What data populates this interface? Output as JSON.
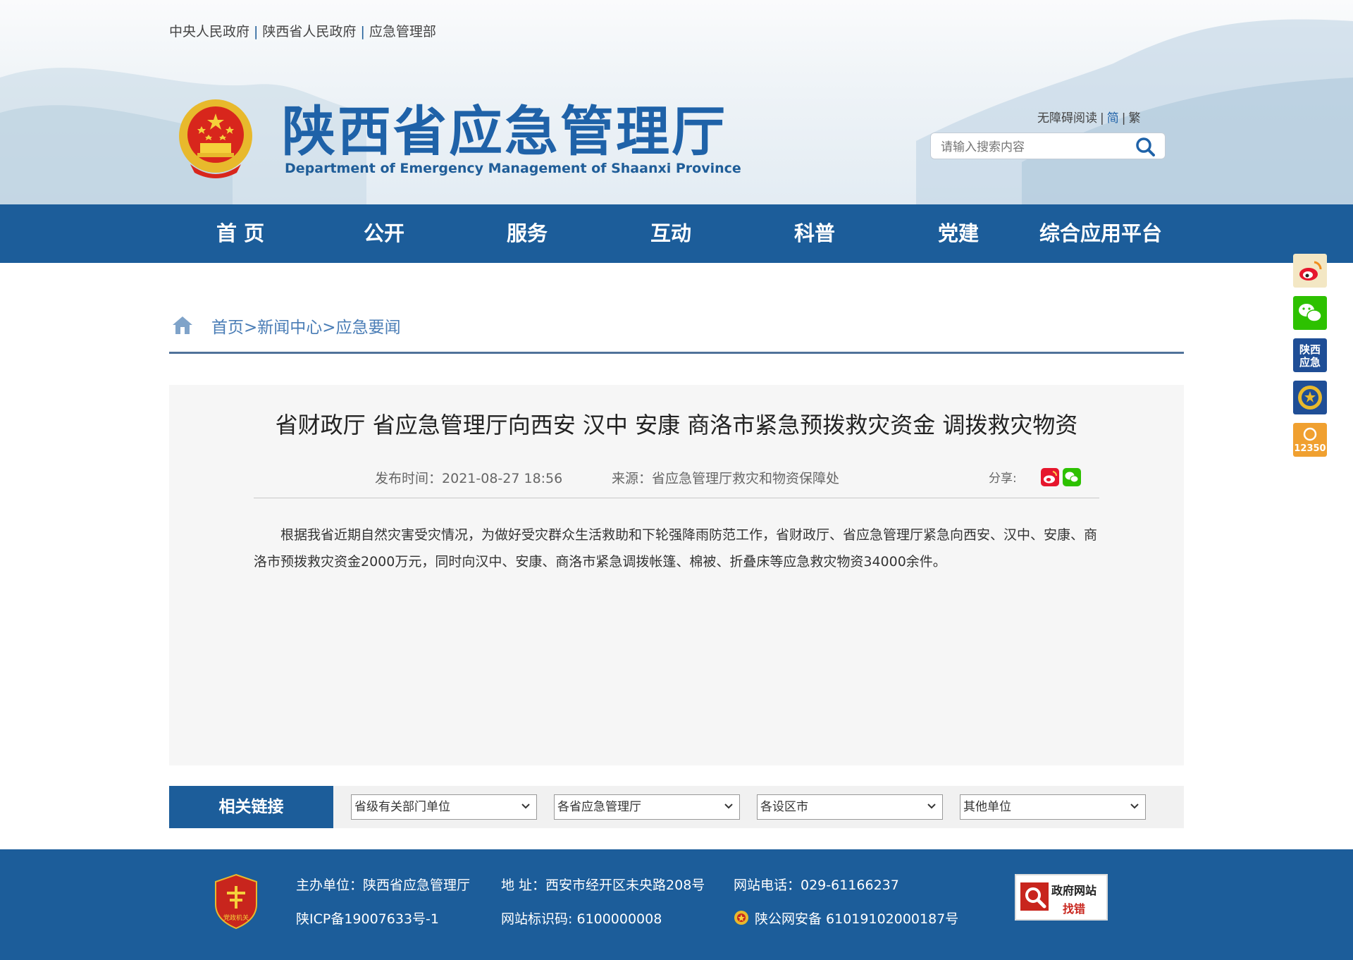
{
  "top_links": [
    "中央人民政府",
    "陕西省人民政府",
    "应急管理部"
  ],
  "site": {
    "title_cn": "陕西省应急管理厅",
    "title_en": "Department of Emergency Management of Shaanxi Province"
  },
  "accessibility": {
    "barrier_free": "无障碍阅读",
    "simplified": "简",
    "traditional": "繁"
  },
  "search": {
    "placeholder": "请输入搜索内容"
  },
  "nav": [
    "首 页",
    "公开",
    "服务",
    "互动",
    "科普",
    "党建",
    "综合应用平台"
  ],
  "breadcrumb": {
    "items": [
      "首页",
      "新闻中心",
      "应急要闻"
    ],
    "separator": ">"
  },
  "article": {
    "title": "省财政厅 省应急管理厅向西安 汉中 安康 商洛市紧急预拨救灾资金 调拨救灾物资",
    "date_label": "发布时间：",
    "date": "2021-08-27 18:56",
    "source_label": "来源：",
    "source": "省应急管理厅救灾和物资保障处",
    "share_label": "分享:",
    "body": "根据我省近期自然灾害受灾情况，为做好受灾群众生活救助和下轮强降雨防范工作，省财政厅、省应急管理厅紧急向西安、汉中、安康、商洛市预拨救灾资金2000万元，同时向汉中、安康、商洛市紧急调拨帐篷、棉被、折叠床等应急救灾物资34000余件。"
  },
  "related_links": {
    "label": "相关链接",
    "selects": [
      "省级有关部门单位",
      "各省应急管理厅",
      "各设区市",
      "其他单位"
    ]
  },
  "footer": {
    "host": "主办单位：陕西省应急管理厅",
    "address": "地 址：西安市经开区未央路208号",
    "phone": "网站电话：029-61166237",
    "icp": "陕ICP备19007633号-1",
    "site_code": "网站标识码: 6100000008",
    "police": "陕公网安备 61019102000187号",
    "find_error_1": "政府网站",
    "find_error_2": "找错",
    "party_badge": "党政机关"
  },
  "float_icons": [
    "weibo-icon",
    "wechat-icon",
    "shaanxi-emergency-icon",
    "fire-rescue-icon",
    "hotline-12350-icon"
  ],
  "float_text": {
    "shaanxi_1": "陕西",
    "shaanxi_2": "应急",
    "hotline": "12350"
  },
  "colors": {
    "brand_blue": "#1c5d9a",
    "title_blue": "#1f62a8",
    "crumb_blue": "#4a7db6",
    "weibo_red": "#e6162d",
    "wechat_green": "#2dc100",
    "hotline_orange": "#f0a030"
  }
}
